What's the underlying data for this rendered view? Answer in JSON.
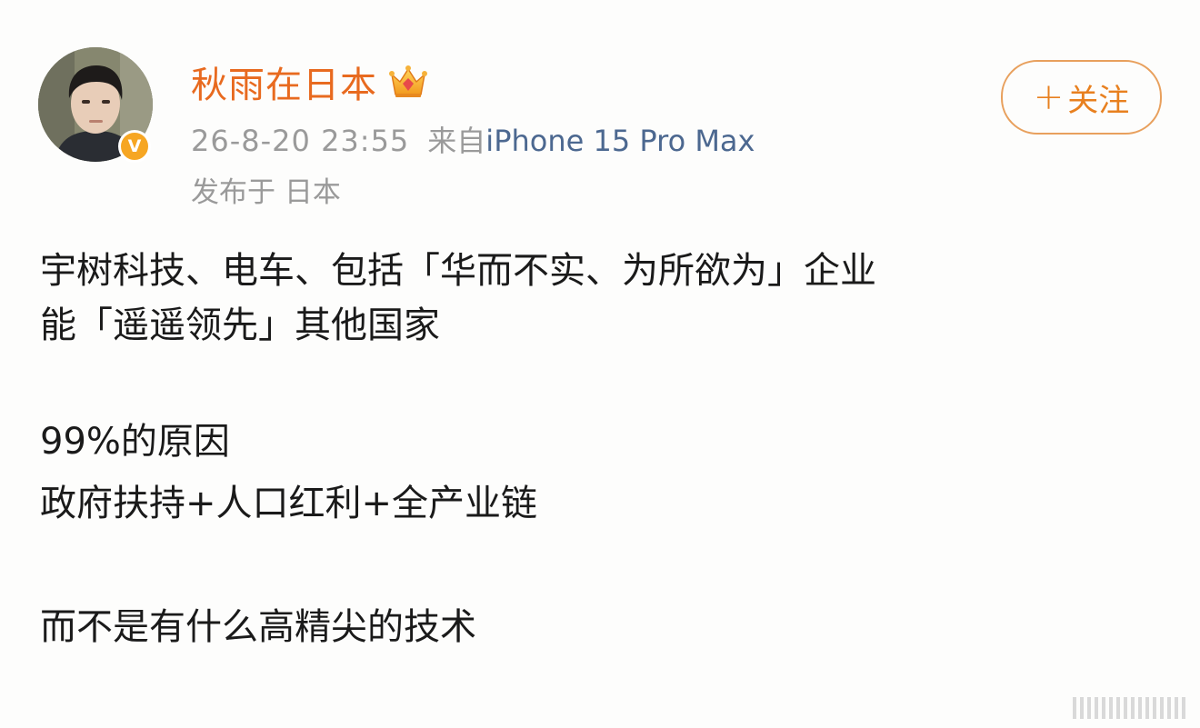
{
  "post": {
    "author": {
      "name": "秋雨在日本",
      "avatar_icon": "user-avatar",
      "verified_icon": "verified-v-icon",
      "vip_icon": "crown-icon"
    },
    "meta": {
      "time": "26-8-20 23:55",
      "source_prefix": "来自",
      "source_device": "iPhone 15 Pro Max",
      "location": "发布于 日本"
    },
    "follow_button": {
      "plus": "+",
      "label": "关注"
    },
    "content_lines": [
      "宇树科技、电车、包括「华而不实、为所欲为」企业",
      "能「遥遥领先」其他国家",
      "",
      "99%的原因",
      "政府扶持+人口红利+全产业链",
      "",
      "而不是有什么高精尖的技术"
    ]
  },
  "colors": {
    "username": "#e86a1f",
    "device_link": "#4c6890",
    "meta_text": "#9a9a9a",
    "follow_border": "#e8a05d",
    "verified_badge": "#f6a623"
  }
}
